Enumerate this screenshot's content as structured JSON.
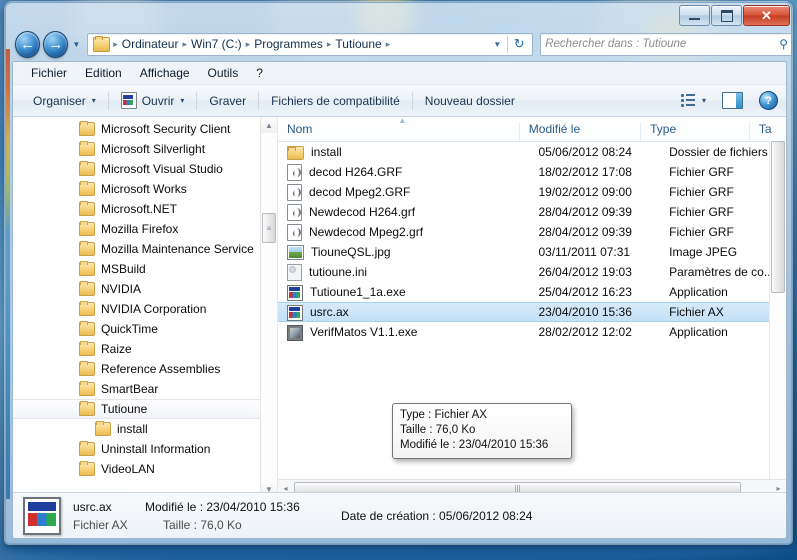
{
  "window": {
    "title": "",
    "buttons": {
      "minimize": "minimize-button",
      "maximize": "maximize-button",
      "close": "✕"
    }
  },
  "address_bar": {
    "back": "←",
    "forward": "→",
    "history_caret": "▼",
    "crumbs": [
      "Ordinateur",
      "Win7 (C:)",
      "Programmes",
      "Tutioune"
    ],
    "separator": "▸",
    "dropdown_caret": "▼",
    "refresh": "↻"
  },
  "search": {
    "placeholder": "Rechercher dans : Tutioune",
    "icon": "⚲"
  },
  "menu": {
    "items": [
      "Fichier",
      "Edition",
      "Affichage",
      "Outils",
      "?"
    ]
  },
  "toolbar": {
    "organize": "Organiser",
    "open": "Ouvrir",
    "burn": "Graver",
    "compat": "Fichiers de compatibilité",
    "new_folder": "Nouveau dossier",
    "caret": "▾",
    "views_caret": "▾",
    "help": "?"
  },
  "nav_pane": {
    "items": [
      {
        "label": "Microsoft Security Client",
        "indent": 0,
        "selected": false
      },
      {
        "label": "Microsoft Silverlight",
        "indent": 0,
        "selected": false
      },
      {
        "label": "Microsoft Visual Studio",
        "indent": 0,
        "selected": false
      },
      {
        "label": "Microsoft Works",
        "indent": 0,
        "selected": false
      },
      {
        "label": "Microsoft.NET",
        "indent": 0,
        "selected": false
      },
      {
        "label": "Mozilla Firefox",
        "indent": 0,
        "selected": false
      },
      {
        "label": "Mozilla Maintenance Service",
        "indent": 0,
        "selected": false
      },
      {
        "label": "MSBuild",
        "indent": 0,
        "selected": false
      },
      {
        "label": "NVIDIA",
        "indent": 0,
        "selected": false
      },
      {
        "label": "NVIDIA Corporation",
        "indent": 0,
        "selected": false
      },
      {
        "label": "QuickTime",
        "indent": 0,
        "selected": false
      },
      {
        "label": "Raize",
        "indent": 0,
        "selected": false
      },
      {
        "label": "Reference Assemblies",
        "indent": 0,
        "selected": false
      },
      {
        "label": "SmartBear",
        "indent": 0,
        "selected": false
      },
      {
        "label": "Tutioune",
        "indent": 0,
        "selected": true
      },
      {
        "label": "install",
        "indent": 1,
        "selected": false
      },
      {
        "label": "Uninstall Information",
        "indent": 0,
        "selected": false
      },
      {
        "label": "VideoLAN",
        "indent": 0,
        "selected": false
      }
    ],
    "scroll_up": "▲",
    "scroll_down": "▼"
  },
  "file_list": {
    "columns": [
      "Nom",
      "Modifié le",
      "Type",
      "Ta"
    ],
    "sort_indicator": "▲",
    "rows": [
      {
        "name": "install",
        "modified": "05/06/2012 08:24",
        "type": "Dossier de fichiers",
        "icon": "folder-icon",
        "selected": false
      },
      {
        "name": "decod H264.GRF",
        "modified": "18/02/2012 17:08",
        "type": "Fichier GRF",
        "icon": "grf-file-icon",
        "selected": false
      },
      {
        "name": "decod Mpeg2.GRF",
        "modified": "19/02/2012 09:00",
        "type": "Fichier GRF",
        "icon": "grf-file-icon",
        "selected": false
      },
      {
        "name": "Newdecod H264.grf",
        "modified": "28/04/2012 09:39",
        "type": "Fichier GRF",
        "icon": "grf-file-icon",
        "selected": false
      },
      {
        "name": "Newdecod Mpeg2.grf",
        "modified": "28/04/2012 09:39",
        "type": "Fichier GRF",
        "icon": "grf-file-icon",
        "selected": false
      },
      {
        "name": "TiouneQSL.jpg",
        "modified": "03/11/2011 07:31",
        "type": "Image JPEG",
        "icon": "jpeg-image-icon",
        "selected": false
      },
      {
        "name": "tutioune.ini",
        "modified": "26/04/2012 19:03",
        "type": "Paramètres de co...",
        "icon": "ini-file-icon",
        "selected": false
      },
      {
        "name": "Tutioune1_1a.exe",
        "modified": "25/04/2012 16:23",
        "type": "Application",
        "icon": "exe-file-icon",
        "selected": false
      },
      {
        "name": "usrc.ax",
        "modified": "23/04/2010 15:36",
        "type": "Fichier AX",
        "icon": "ax-file-icon",
        "selected": true
      },
      {
        "name": "VerifMatos V1.1.exe",
        "modified": "28/02/2012 12:02",
        "type": "Application",
        "icon": "app-icon",
        "selected": false
      }
    ],
    "hscroll": {
      "left_arrow": "◂",
      "right_arrow": "▸",
      "grip": "|||"
    }
  },
  "tooltip": {
    "line1": "Type : Fichier AX",
    "line2": "Taille : 76,0 Ko",
    "line3": "Modifié le : 23/04/2010 15:36"
  },
  "details_pane": {
    "file_name": "usrc.ax",
    "file_type": "Fichier AX",
    "modified_label": "Modifié le : 23/04/2010 15:36",
    "size_label": "Taille : 76,0 Ko",
    "created_label": "Date de création : 05/06/2012 08:24"
  },
  "colors": {
    "selection": "#c3e0f7",
    "column_header_text": "#2a5a8a",
    "close_button": "#c43c22"
  }
}
